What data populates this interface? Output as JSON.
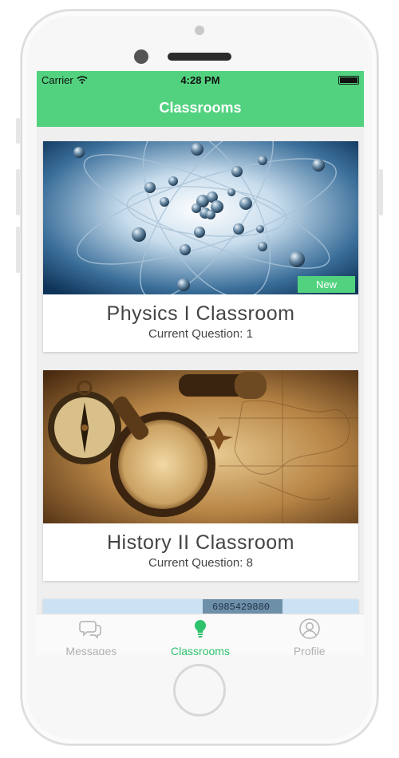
{
  "status_bar": {
    "carrier": "Carrier",
    "time": "4:28 PM"
  },
  "nav": {
    "title": "Classrooms"
  },
  "classrooms": [
    {
      "title": "Physics I Classroom",
      "subtitle": "Current Question: 1",
      "badge": "New",
      "image": "atom-model-image"
    },
    {
      "title": "History II Classroom",
      "subtitle": "Current Question: 8",
      "image": "antique-map-compass-image"
    },
    {
      "image": "calculator-image",
      "display_text": "6985429880"
    }
  ],
  "tabbar": {
    "items": [
      {
        "label": "Messages",
        "icon": "chat-bubbles-icon",
        "active": false
      },
      {
        "label": "Classrooms",
        "icon": "lightbulb-icon",
        "active": true
      },
      {
        "label": "Profile",
        "icon": "person-icon",
        "active": false
      }
    ]
  },
  "colors": {
    "accent": "#52d27f",
    "accent_text": "#2ec26c",
    "inactive": "#b0b0b0",
    "text": "#444444"
  }
}
